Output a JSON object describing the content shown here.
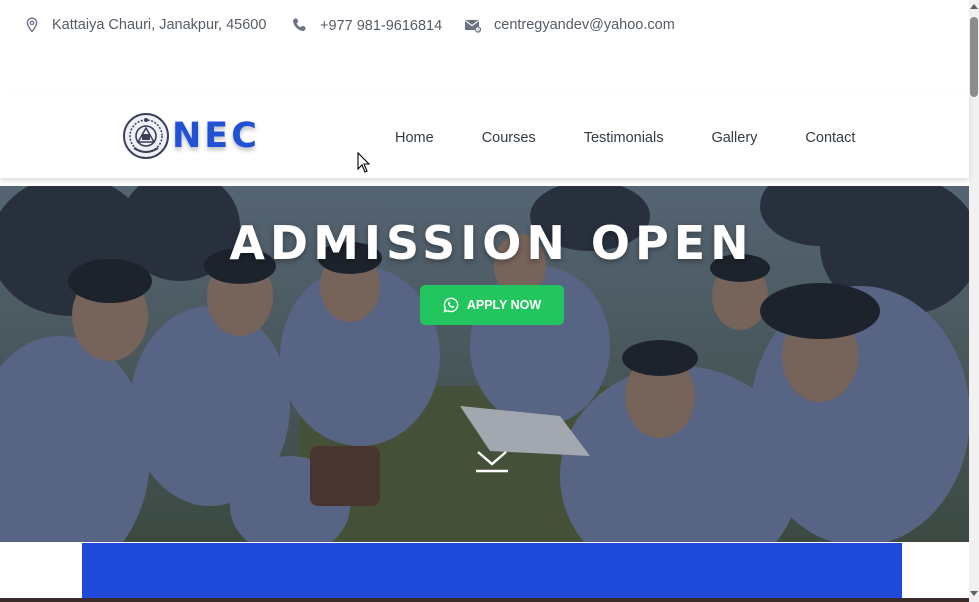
{
  "topbar": {
    "address": "Kattaiya Chauri, Janakpur, 45600",
    "address_icon": "map-pin-icon",
    "phone": "+977 981-9616814",
    "phone_icon": "phone-icon",
    "email": "centregyandev@yahoo.com",
    "email_icon": "mail-icon"
  },
  "header": {
    "logo_text": "NEC",
    "logo_icon": "college-emblem",
    "brand_color": "#2152d6",
    "nav": [
      {
        "label": "Home"
      },
      {
        "label": "Courses"
      },
      {
        "label": "Testimonials"
      },
      {
        "label": "Gallery"
      },
      {
        "label": "Contact"
      }
    ]
  },
  "hero": {
    "title": "ADMISSION OPEN",
    "cta_label": "APPLY NOW",
    "cta_icon": "whatsapp-icon",
    "cta_color": "#22c55e",
    "scroll_icon": "chevron-down-icon",
    "background": "photo of students sitting together on grass"
  },
  "band": {
    "color": "#1f4ad9"
  }
}
